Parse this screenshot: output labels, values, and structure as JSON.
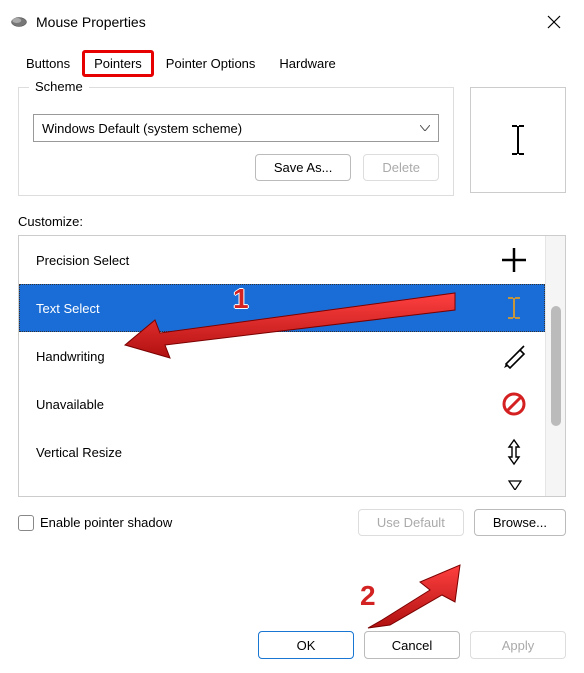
{
  "window": {
    "title": "Mouse Properties"
  },
  "tabs": {
    "buttons": "Buttons",
    "pointers": "Pointers",
    "pointer_options": "Pointer Options",
    "hardware": "Hardware",
    "active": "Pointers"
  },
  "scheme": {
    "group_label": "Scheme",
    "selected": "Windows Default (system scheme)",
    "save_as": "Save As...",
    "delete": "Delete"
  },
  "customize_label": "Customize:",
  "list": {
    "items": [
      {
        "label": "Precision Select",
        "icon": "plus-cursor"
      },
      {
        "label": "Text Select",
        "icon": "ibeam-cursor",
        "selected": true
      },
      {
        "label": "Handwriting",
        "icon": "pen-cursor"
      },
      {
        "label": "Unavailable",
        "icon": "no-cursor"
      },
      {
        "label": "Vertical Resize",
        "icon": "vresize-cursor"
      }
    ]
  },
  "bottom": {
    "enable_shadow": "Enable pointer shadow",
    "use_default": "Use Default",
    "browse": "Browse..."
  },
  "dialog": {
    "ok": "OK",
    "cancel": "Cancel",
    "apply": "Apply"
  },
  "annotations": {
    "num1": "1",
    "num2": "2"
  }
}
